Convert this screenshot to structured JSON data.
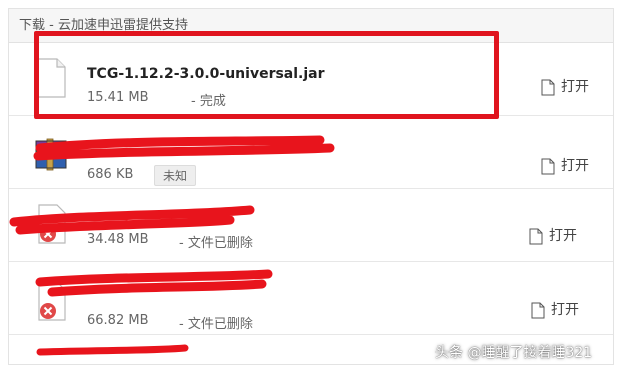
{
  "header": {
    "title": "下载 - 云加速申迅雷提供支持"
  },
  "rows": [
    {
      "filename": "TCG-1.12.2-3.0.0-universal.jar",
      "size": "15.41 MB",
      "status": "- 完成",
      "open_label": "打开",
      "icon": "file-icon"
    },
    {
      "filename": "",
      "size": "686 KB",
      "badge": "未知",
      "open_label": "打开",
      "icon": "winrar-archive-icon"
    },
    {
      "filename": "",
      "size": "34.48 MB",
      "status": "- 文件已删除",
      "open_label": "打开",
      "icon": "deleted-file-icon"
    },
    {
      "filename": "",
      "size": "66.82 MB",
      "status": "- 文件已删除",
      "open_label": "打开",
      "icon": "deleted-file-icon"
    }
  ],
  "watermark": "头条 @睡醒了接着睡321",
  "colors": {
    "highlight": "#e0141e",
    "redaction": "#e8141c"
  }
}
